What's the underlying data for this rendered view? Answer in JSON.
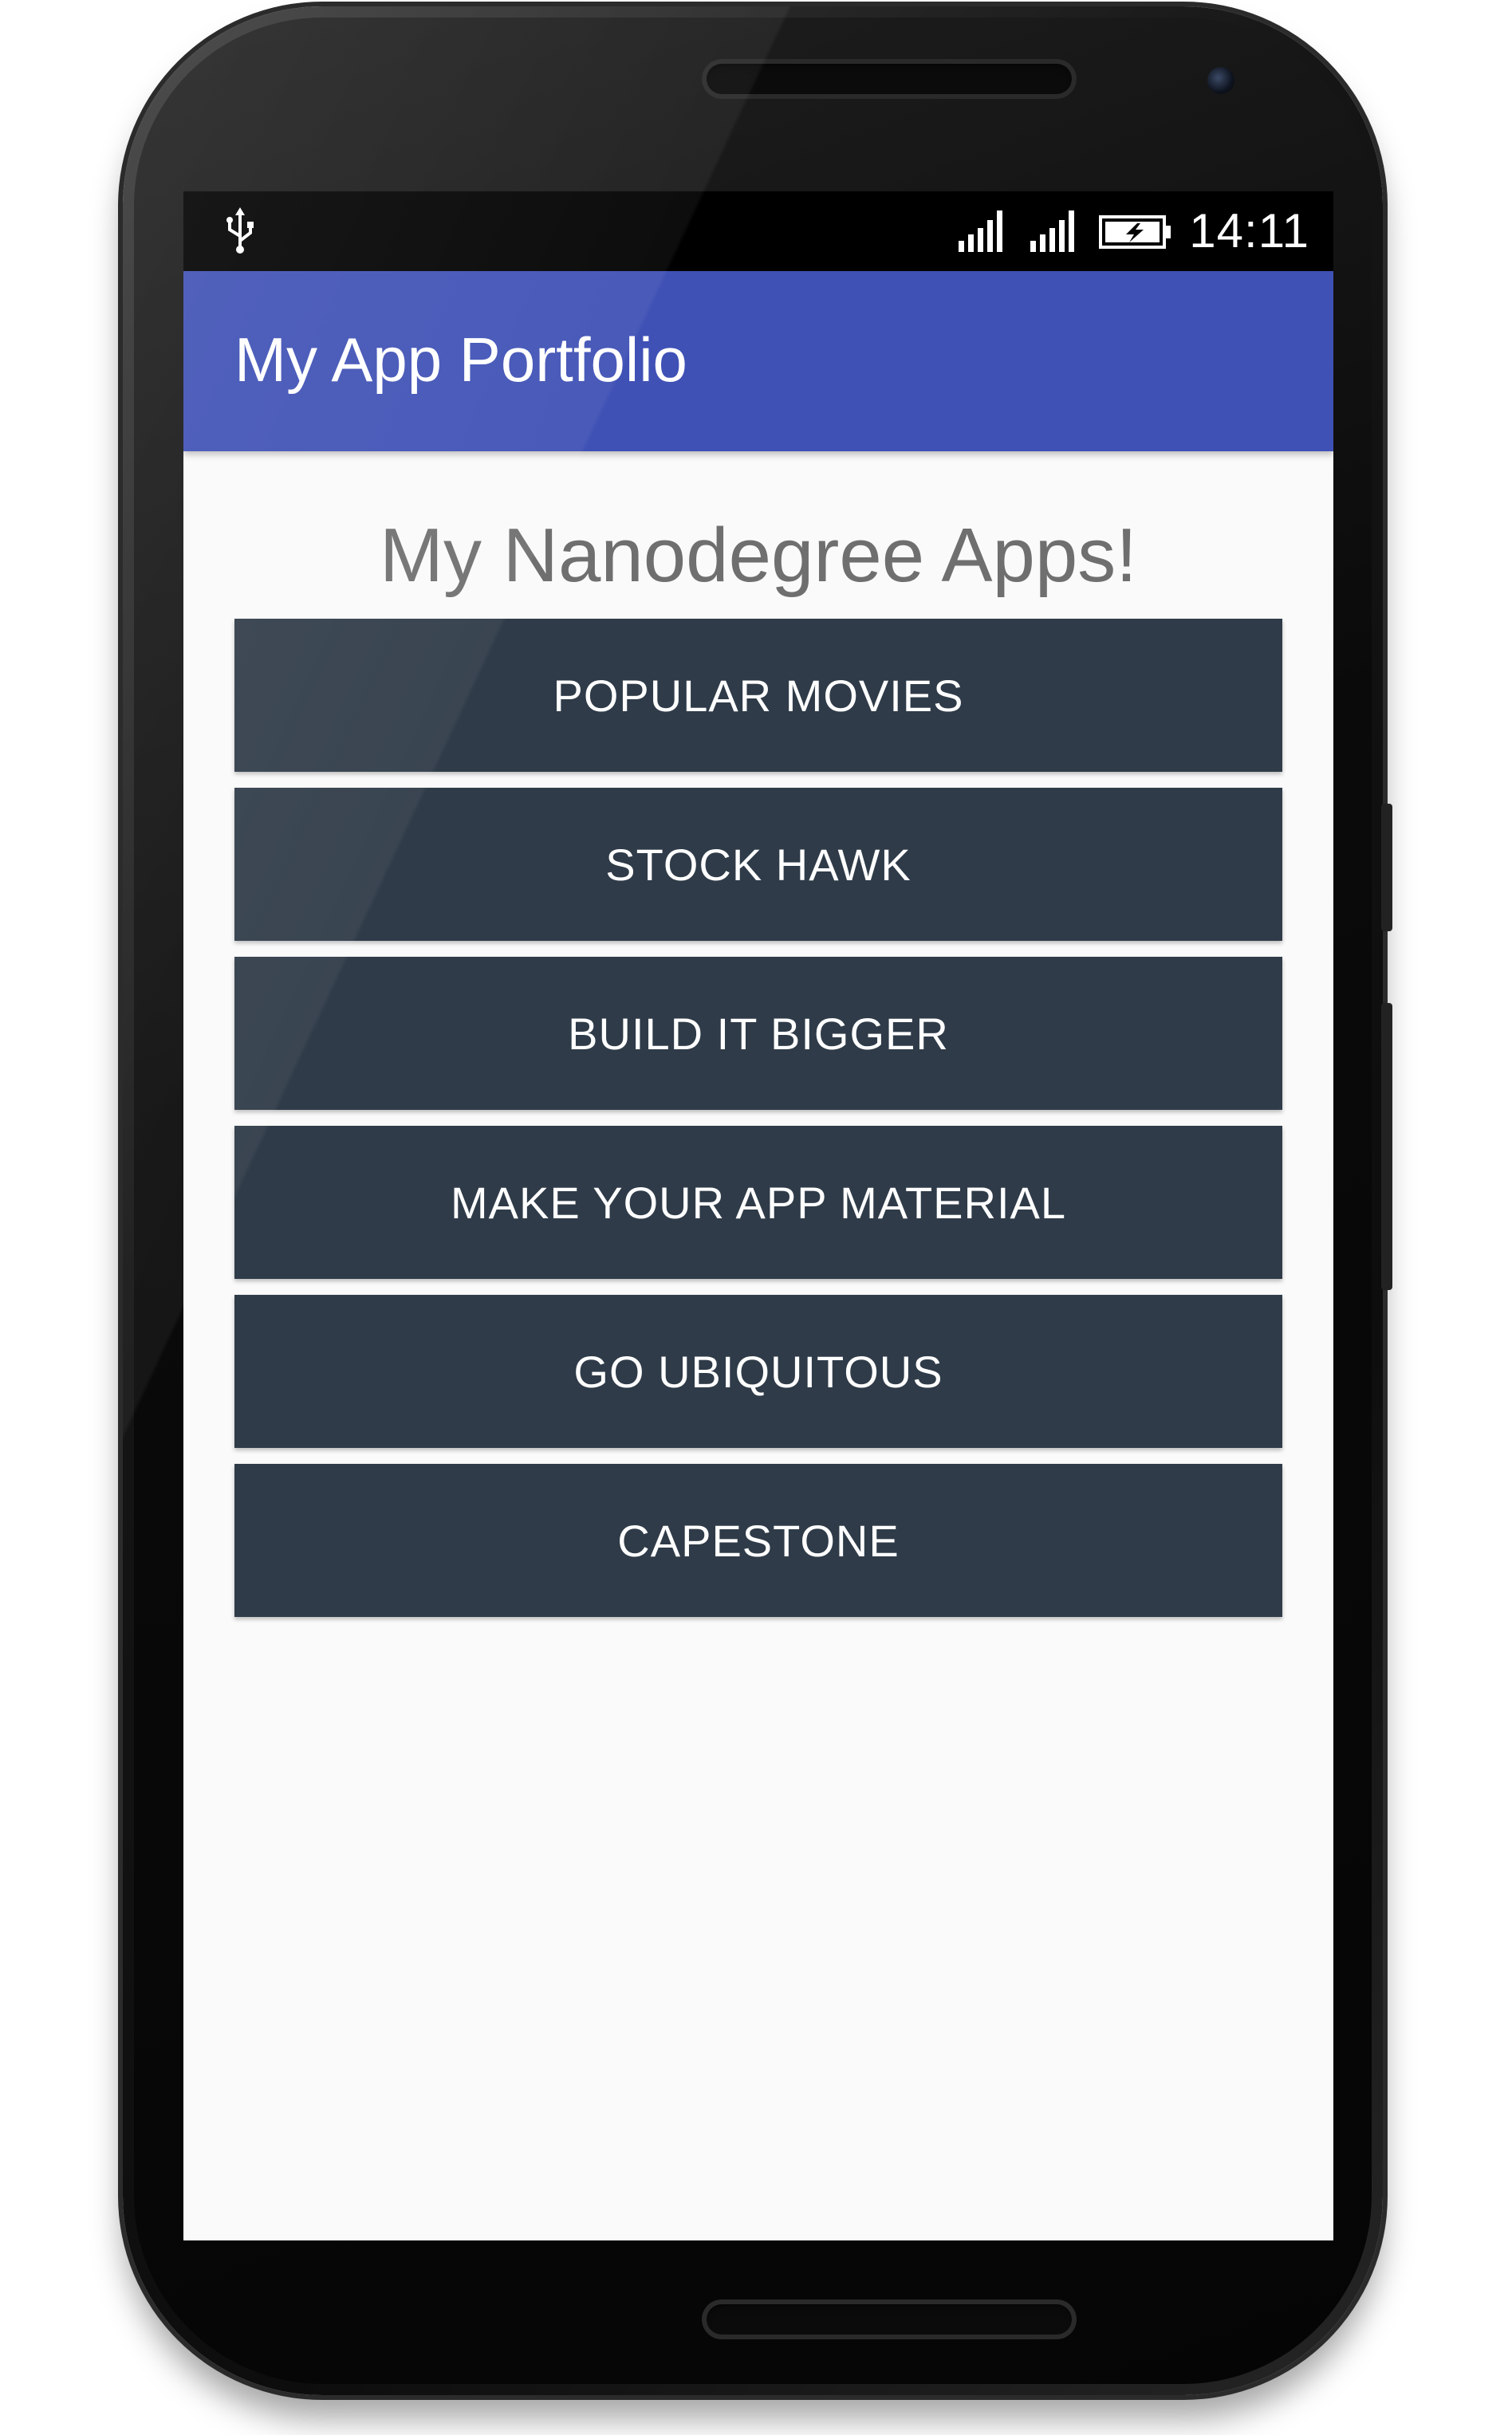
{
  "status_bar": {
    "time": "14:11",
    "icons": [
      "usb-icon",
      "signal-icon",
      "signal-icon",
      "battery-charging-icon"
    ]
  },
  "app_bar": {
    "title": "My App Portfolio"
  },
  "main": {
    "headline": "My Nanodegree Apps!",
    "buttons": [
      "POPULAR MOVIES",
      "STOCK HAWK",
      "BUILD IT BIGGER",
      "MAKE YOUR APP MATERIAL",
      "GO UBIQUITOUS",
      "CAPESTONE"
    ]
  },
  "colors": {
    "primary": "#3f51b5",
    "button_bg": "#2f3b48",
    "headline_text": "#6f6f6f",
    "screen_bg": "#fafafa"
  }
}
